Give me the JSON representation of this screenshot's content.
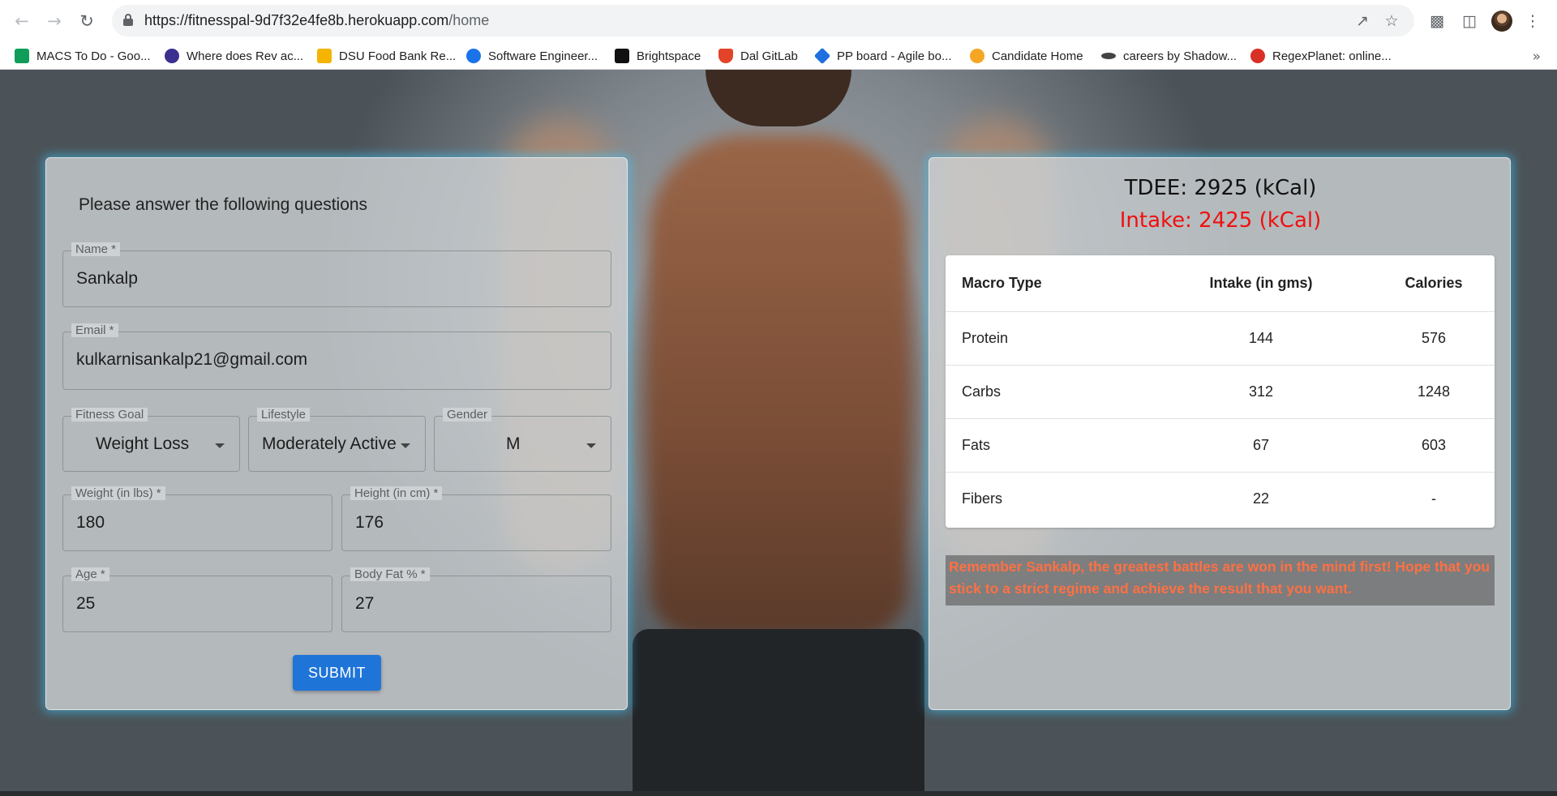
{
  "browser": {
    "url_host": "https://fitnesspal-9d7f32e4fe8b.herokuapp.com",
    "url_path": "/home",
    "bookmarks": [
      {
        "label": "MACS To Do - Goo...",
        "icon_color": "#0f9d58"
      },
      {
        "label": "Where does Rev ac...",
        "icon_color": "#3b2f8f"
      },
      {
        "label": "DSU Food Bank Re...",
        "icon_color": "#f4b400"
      },
      {
        "label": "Software Engineer...",
        "icon_color": "#1a73e8"
      },
      {
        "label": "Brightspace",
        "icon_color": "#111111"
      },
      {
        "label": "Dal GitLab",
        "icon_color": "#e24329"
      },
      {
        "label": "PP board - Agile bo...",
        "icon_color": "#1f6fe0"
      },
      {
        "label": "Candidate Home",
        "icon_color": "#f5a623"
      },
      {
        "label": "careers by Shadow...",
        "icon_color": "#444444"
      },
      {
        "label": "RegexPlanet: online...",
        "icon_color": "#d93025"
      }
    ]
  },
  "form": {
    "title": "Please answer the following questions",
    "name": {
      "label": "Name *",
      "value": "Sankalp"
    },
    "email": {
      "label": "Email *",
      "value": "kulkarnisankalp21@gmail.com"
    },
    "fitness_goal": {
      "label": "Fitness Goal",
      "value": "Weight Loss"
    },
    "lifestyle": {
      "label": "Lifestyle",
      "value": "Moderately Active"
    },
    "gender": {
      "label": "Gender",
      "value": "M"
    },
    "weight": {
      "label": "Weight (in lbs) *",
      "value": "180"
    },
    "height": {
      "label": "Height (in cm) *",
      "value": "176"
    },
    "age": {
      "label": "Age *",
      "value": "25"
    },
    "body_fat": {
      "label": "Body Fat % *",
      "value": "27"
    },
    "submit_label": "SUBMIT"
  },
  "result": {
    "tdee": "TDEE: 2925 (kCal)",
    "intake": "Intake: 2425 (kCal)",
    "table": {
      "headers": [
        "Macro Type",
        "Intake (in gms)",
        "Calories"
      ],
      "rows": [
        [
          "Protein",
          "144",
          "576"
        ],
        [
          "Carbs",
          "312",
          "1248"
        ],
        [
          "Fats",
          "67",
          "603"
        ],
        [
          "Fibers",
          "22",
          "-"
        ]
      ]
    },
    "quote": "Remember Sankalp, the greatest battles are won in the mind first! Hope that you stick to a strict regime and achieve the result that you want."
  },
  "colors": {
    "accent": "#1f74d8",
    "intake": "#f01010",
    "quote": "#ff7043",
    "glow": "#3cc8ff"
  }
}
